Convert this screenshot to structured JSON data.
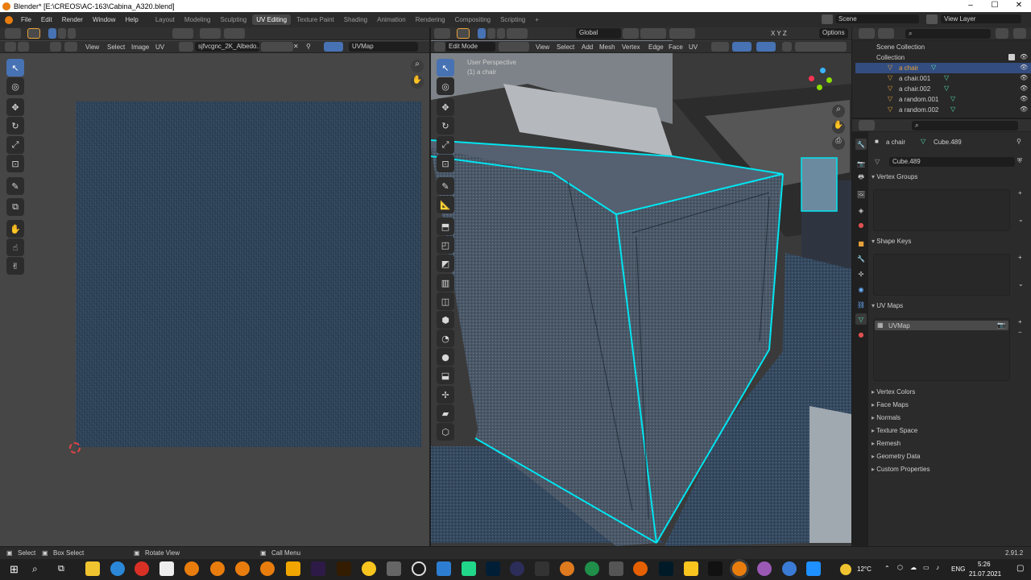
{
  "window": {
    "title": "Blender* [E:\\CREOS\\AC-163\\Cabina_A320.blend]",
    "minimize": "–",
    "maximize": "☐",
    "close": "✕"
  },
  "menu": [
    "File",
    "Edit",
    "Render",
    "Window",
    "Help"
  ],
  "workspaces": [
    "Layout",
    "Modeling",
    "Sculpting",
    "UV Editing",
    "Texture Paint",
    "Shading",
    "Animation",
    "Rendering",
    "Compositing",
    "Scripting",
    "+"
  ],
  "scene": {
    "label": "Scene",
    "view_layer": "View Layer"
  },
  "uv_editor": {
    "menus": [
      "View",
      "Select",
      "Image",
      "UV"
    ],
    "image_name": "sjfvcgnc_2K_Albedo...",
    "uvmap": "UVMap"
  },
  "viewport": {
    "mode": "Edit Mode",
    "menus": [
      "View",
      "Select",
      "Add",
      "Mesh",
      "Vertex",
      "Edge",
      "Face",
      "UV"
    ],
    "orientation": "Global",
    "axes": "X Y Z",
    "options": "Options",
    "overlay_title": "User Perspective",
    "overlay_object": "(1) a chair"
  },
  "outliner": {
    "root": "Scene Collection",
    "collection": "Collection",
    "items": [
      "a chair",
      "a chair.001",
      "a chair.002",
      "a random.001",
      "a random.002"
    ]
  },
  "properties": {
    "object": "a chair",
    "mesh": "Cube.489",
    "mesh_field": "Cube.489",
    "panels": {
      "vertex_groups": "Vertex Groups",
      "shape_keys": "Shape Keys",
      "uv_maps": "UV Maps",
      "uv_item": "UVMap"
    },
    "collapsed": [
      "Vertex Colors",
      "Face Maps",
      "Normals",
      "Texture Space",
      "Remesh",
      "Geometry Data",
      "Custom Properties"
    ]
  },
  "status": {
    "select": "Select",
    "box_select": "Box Select",
    "rotate_view": "Rotate View",
    "call_menu": "Call Menu",
    "version": "2.91.2"
  },
  "taskbar": {
    "temperature": "12°C",
    "lang": "ENG",
    "time": "5:26",
    "date": "21.07.2021"
  },
  "colors": {
    "accent": "#4772b3",
    "wire": "#00e5f0",
    "fabric": "#2d4359",
    "active_tab": "#474747"
  }
}
